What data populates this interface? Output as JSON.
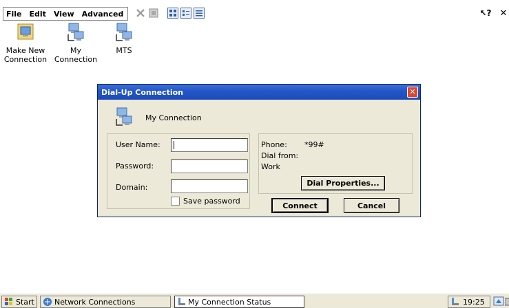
{
  "menubar": {
    "items": [
      "File",
      "Edit",
      "View",
      "Advanced"
    ],
    "help_glyph": "?",
    "close_glyph": "✕",
    "toolbar_icons": [
      "delete-icon",
      "properties-icon",
      "large-icons-view-icon",
      "small-icons-view-icon",
      "details-view-icon"
    ]
  },
  "desktop": {
    "icons": [
      {
        "label_line1": "Make New",
        "label_line2": "Connection",
        "icon": "make-new-connection-icon"
      },
      {
        "label_line1": "My",
        "label_line2": "Connection",
        "icon": "network-connection-icon"
      },
      {
        "label_line1": "MTS",
        "label_line2": "",
        "icon": "network-connection-icon"
      }
    ]
  },
  "dialog": {
    "title": "Dial-Up Connection",
    "close_glyph": "✕",
    "connection_name": "My Connection",
    "fields": {
      "user_name": {
        "label": "User Name:",
        "value": ""
      },
      "password": {
        "label": "Password:",
        "value": ""
      },
      "domain": {
        "label": "Domain:",
        "value": ""
      }
    },
    "save_password": {
      "label": "Save password",
      "checked": false
    },
    "info": {
      "phone_label": "Phone:",
      "phone_value": "*99#",
      "dial_from_label": "Dial from:",
      "dial_from_value": "Work"
    },
    "dial_properties_label": "Dial Properties...",
    "connect_label": "Connect",
    "cancel_label": "Cancel"
  },
  "taskbar": {
    "start_label": "Start",
    "tasks": [
      {
        "label": "Network Connections",
        "active": false
      },
      {
        "label": "My Connection Status",
        "active": true
      }
    ],
    "clock": "19:25"
  },
  "colors": {
    "titlebar": "#2457c8",
    "dialog_bg": "#ece9d8",
    "close_red": "#e0462e"
  }
}
